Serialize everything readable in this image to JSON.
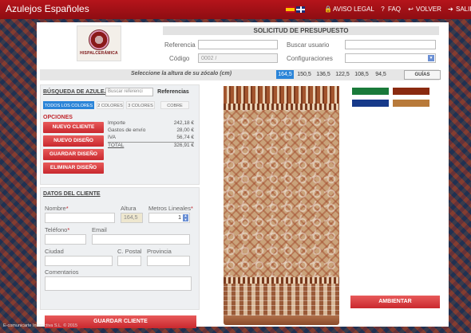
{
  "header": {
    "brand": "Azulejos Españoles",
    "nav": [
      {
        "icon": "lock-icon",
        "glyph": "🔒",
        "label": "AVISO LEGAL"
      },
      {
        "icon": "help-icon",
        "glyph": "?",
        "label": "FAQ"
      },
      {
        "icon": "back-icon",
        "glyph": "↩",
        "label": "VOLVER"
      },
      {
        "icon": "logout-icon",
        "glyph": "➔",
        "label": "SALIR"
      }
    ]
  },
  "logo": {
    "text": "HISPALCERÁMICA"
  },
  "solicitud": {
    "title": "SOLICITUD DE PRESUPUESTO",
    "referencia_label": "Referencia",
    "referencia_value": "",
    "codigo_label": "Código",
    "codigo_value": "0002 /",
    "buscar_usuario_label": "Buscar usuario",
    "configuraciones_label": "Configuraciones"
  },
  "heights": {
    "label": "Seleccione la altura de su zócalo (cm)",
    "options": [
      "164,5",
      "150,5",
      "136,5",
      "122,5",
      "108,5",
      "94,5"
    ],
    "selected": "164,5",
    "guias_label": "GUÍAS"
  },
  "busqueda": {
    "title": "BÚSQUEDA DE AZULEJOS",
    "search_placeholder": "Buscar referenci",
    "referencias_label": "Referencias",
    "color_tabs": [
      "TODOS LOS COLORES",
      "2 COLORES",
      "3 COLORES",
      "COBRE"
    ],
    "active_tab": "TODOS LOS COLORES"
  },
  "opciones": {
    "title": "OPCIONES",
    "buttons": [
      "NUEVO CLIENTE",
      "NUEVO DISEÑO",
      "GUARDAR DISEÑO",
      "ELIMINAR DISEÑO"
    ]
  },
  "prices": [
    {
      "label": "Importe",
      "value": "242,18 €"
    },
    {
      "label": "Gastos de envío",
      "value": "28,00 €"
    },
    {
      "label": "IVA",
      "value": "56,74 €"
    },
    {
      "label": "TOTAL",
      "value": "326,91 €"
    }
  ],
  "cliente": {
    "title": "DATOS DEL CLIENTE",
    "nombre_label": "Nombre",
    "altura_label": "Altura",
    "altura_value": "164,5",
    "metros_label": "Metros Lineales",
    "metros_value": "1",
    "telefono_label": "Teléfono",
    "email_label": "Email",
    "ciudad_label": "Ciudad",
    "cpostal_label": "C. Postal",
    "provincia_label": "Provincia",
    "comentarios_label": "Comentarios",
    "required_mark": "*",
    "save_label": "GUARDAR CLIENTE"
  },
  "swatches": {
    "colors": [
      "#1a7a3a",
      "#8a2a10",
      "#173a8a",
      "#b87a3a"
    ]
  },
  "ambientar_label": "AMBIENTAR",
  "footer": "E-comunicarte Interactiva S.L. © 2015"
}
